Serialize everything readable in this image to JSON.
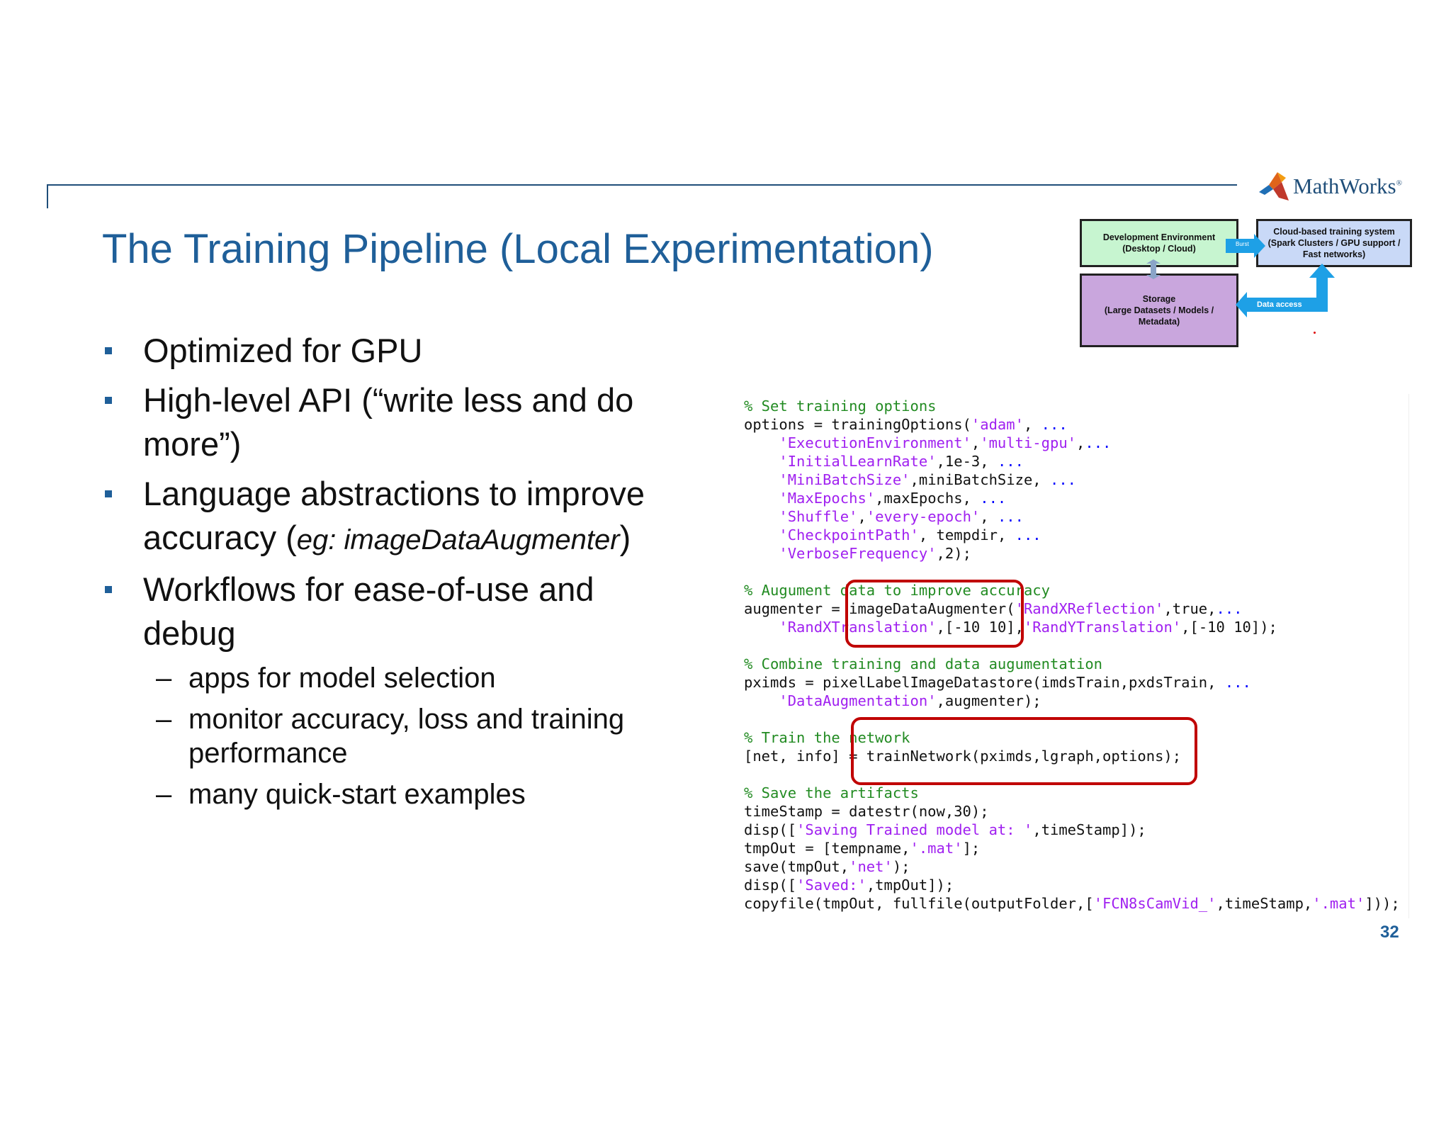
{
  "slide": {
    "title": "The Training Pipeline (Local Experimentation)",
    "page_number": "32",
    "logo_text": "MathWorks",
    "logo_reg": "®"
  },
  "bullets": [
    {
      "lines": [
        "Optimized for GPU"
      ]
    },
    {
      "lines": [
        "High-level API (“write less and do",
        "more”)"
      ]
    },
    {
      "prefix": "Language abstractions to improve",
      "line2_start": "accuracy (",
      "line2_italic": "eg: imageDataAugmenter",
      "line2_end": ")"
    },
    {
      "lines": [
        "Workflows for ease-of-use and",
        "debug"
      ]
    }
  ],
  "sub_bullets": {
    "dash": "–",
    "items": [
      {
        "lines": [
          "apps for model selection"
        ]
      },
      {
        "lines": [
          "monitor accuracy, loss and training",
          "performance"
        ]
      },
      {
        "lines": [
          "many quick-start examples"
        ]
      }
    ]
  },
  "diagram": {
    "dev_env": [
      "Development Environment",
      "(Desktop / Cloud)"
    ],
    "cloud": [
      "Cloud-based training system",
      "(Spark Clusters / GPU support /",
      "Fast networks)"
    ],
    "storage": [
      "Storage",
      "(Large Datasets / Models /",
      "Metadata)"
    ],
    "burst_label": "Burst",
    "data_access_label": "Data access",
    "colors": {
      "dev": "#c7f5d0",
      "cloud": "#c9d9f7",
      "storage": "#c9a6dd",
      "arrow": "#1ea0e6"
    }
  },
  "code": [
    [
      [
        "c",
        "% Set training options"
      ]
    ],
    [
      [
        "p",
        "options = trainingOptions("
      ],
      [
        "s",
        "'adam'"
      ],
      [
        "p",
        ", "
      ],
      [
        "e",
        "..."
      ]
    ],
    [
      [
        "p",
        "    "
      ],
      [
        "s",
        "'ExecutionEnvironment'"
      ],
      [
        "p",
        ","
      ],
      [
        "s",
        "'multi-gpu'"
      ],
      [
        "p",
        ","
      ],
      [
        "e",
        "..."
      ]
    ],
    [
      [
        "p",
        "    "
      ],
      [
        "s",
        "'InitialLearnRate'"
      ],
      [
        "p",
        ",1e-3, "
      ],
      [
        "e",
        "..."
      ]
    ],
    [
      [
        "p",
        "    "
      ],
      [
        "s",
        "'MiniBatchSize'"
      ],
      [
        "p",
        ",miniBatchSize, "
      ],
      [
        "e",
        "..."
      ]
    ],
    [
      [
        "p",
        "    "
      ],
      [
        "s",
        "'MaxEpochs'"
      ],
      [
        "p",
        ",maxEpochs, "
      ],
      [
        "e",
        "..."
      ]
    ],
    [
      [
        "p",
        "    "
      ],
      [
        "s",
        "'Shuffle'"
      ],
      [
        "p",
        ","
      ],
      [
        "s",
        "'every-epoch'"
      ],
      [
        "p",
        ", "
      ],
      [
        "e",
        "..."
      ]
    ],
    [
      [
        "p",
        "    "
      ],
      [
        "s",
        "'CheckpointPath'"
      ],
      [
        "p",
        ", tempdir, "
      ],
      [
        "e",
        "..."
      ]
    ],
    [
      [
        "p",
        "    "
      ],
      [
        "s",
        "'VerboseFrequency'"
      ],
      [
        "p",
        ",2);"
      ]
    ],
    [],
    [
      [
        "c",
        "% Augument data to improve accuracy"
      ]
    ],
    [
      [
        "p",
        "augmenter = imageDataAugmenter("
      ],
      [
        "s",
        "'RandXReflection'"
      ],
      [
        "p",
        ",true,"
      ],
      [
        "e",
        "..."
      ]
    ],
    [
      [
        "p",
        "    "
      ],
      [
        "s",
        "'RandXTranslation'"
      ],
      [
        "p",
        ",[-10 10],"
      ],
      [
        "s",
        "'RandYTranslation'"
      ],
      [
        "p",
        ",[-10 10]);"
      ]
    ],
    [],
    [
      [
        "c",
        "% Combine training and data augumentation"
      ]
    ],
    [
      [
        "p",
        "pximds = pixelLabelImageDatastore(imdsTrain,pxdsTrain, "
      ],
      [
        "e",
        "..."
      ]
    ],
    [
      [
        "p",
        "    "
      ],
      [
        "s",
        "'DataAugmentation'"
      ],
      [
        "p",
        ",augmenter);"
      ]
    ],
    [],
    [
      [
        "c",
        "% Train the network"
      ]
    ],
    [
      [
        "p",
        "[net, info] = trainNetwork(pximds,lgraph,options);"
      ]
    ],
    [],
    [
      [
        "c",
        "% Save the artifacts"
      ]
    ],
    [
      [
        "p",
        "timeStamp = datestr(now,30);"
      ]
    ],
    [
      [
        "p",
        "disp(["
      ],
      [
        "s",
        "'Saving Trained model at: '"
      ],
      [
        "p",
        ",timeStamp]);"
      ]
    ],
    [
      [
        "p",
        "tmpOut = [tempname,"
      ],
      [
        "s",
        "'.mat'"
      ],
      [
        "p",
        "];"
      ]
    ],
    [
      [
        "p",
        "save(tmpOut,"
      ],
      [
        "s",
        "'net'"
      ],
      [
        "p",
        ");"
      ]
    ],
    [
      [
        "p",
        "disp(["
      ],
      [
        "s",
        "'Saved:'"
      ],
      [
        "p",
        ",tmpOut]);"
      ]
    ],
    [
      [
        "p",
        "copyfile(tmpOut, fullfile(outputFolder,["
      ],
      [
        "s",
        "'FCN8sCamVid_'"
      ],
      [
        "p",
        ",timeStamp,"
      ],
      [
        "s",
        "'.mat'"
      ],
      [
        "p",
        "]));"
      ]
    ]
  ]
}
